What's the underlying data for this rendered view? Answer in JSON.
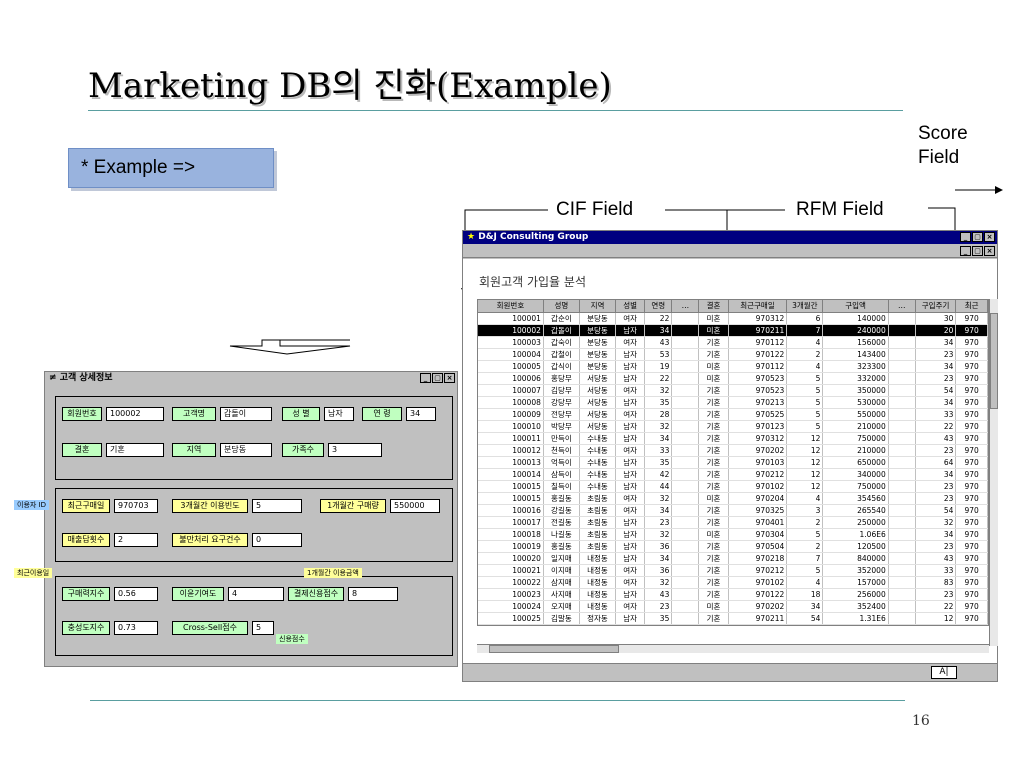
{
  "slide": {
    "title": "Marketing DB의 진화(Example)",
    "example_label": "* Example =>",
    "score_field_label": "Score Field",
    "cif_field_label": "CIF Field",
    "rfm_field_label": "RFM Field",
    "page_number": "16"
  },
  "grid_window": {
    "title": "D&J Consulting Group",
    "heading": "회원고객 가입율 분석",
    "status_text": "A|",
    "columns": [
      "회원번호",
      "성명",
      "지역",
      "성별",
      "연령",
      "…",
      "결혼",
      "최근구매일",
      "3개월간",
      "구입액",
      "…",
      "구입주기",
      "최근"
    ],
    "rows": [
      [
        "100001",
        "갑순이",
        "분당동",
        "여자",
        "22",
        "",
        "미혼",
        "970312",
        "6",
        "140000",
        "",
        "30",
        "970"
      ],
      [
        "100002",
        "갑돌이",
        "분당동",
        "남자",
        "34",
        "",
        "미혼",
        "970211",
        "7",
        "240000",
        "",
        "20",
        "970"
      ],
      [
        "100003",
        "갑숙이",
        "분당동",
        "여자",
        "43",
        "",
        "기혼",
        "970112",
        "4",
        "156000",
        "",
        "34",
        "970"
      ],
      [
        "100004",
        "갑철이",
        "분당동",
        "남자",
        "53",
        "",
        "기혼",
        "970122",
        "2",
        "143400",
        "",
        "23",
        "970"
      ],
      [
        "100005",
        "갑식이",
        "분당동",
        "남자",
        "19",
        "",
        "미혼",
        "970112",
        "4",
        "323300",
        "",
        "34",
        "970"
      ],
      [
        "100006",
        "홍당무",
        "서당동",
        "남자",
        "22",
        "",
        "미혼",
        "970523",
        "5",
        "332000",
        "",
        "23",
        "970"
      ],
      [
        "100007",
        "김당무",
        "서당동",
        "여자",
        "32",
        "",
        "기혼",
        "970523",
        "5",
        "350000",
        "",
        "54",
        "970"
      ],
      [
        "100008",
        "강당무",
        "서당동",
        "남자",
        "35",
        "",
        "기혼",
        "970213",
        "5",
        "530000",
        "",
        "34",
        "970"
      ],
      [
        "100009",
        "전당무",
        "서당동",
        "여자",
        "28",
        "",
        "기혼",
        "970525",
        "5",
        "550000",
        "",
        "33",
        "970"
      ],
      [
        "100010",
        "박당무",
        "서당동",
        "남자",
        "32",
        "",
        "기혼",
        "970123",
        "5",
        "210000",
        "",
        "22",
        "970"
      ],
      [
        "100011",
        "만득이",
        "수내동",
        "남자",
        "34",
        "",
        "기혼",
        "970312",
        "12",
        "750000",
        "",
        "43",
        "970"
      ],
      [
        "100012",
        "천득이",
        "수내동",
        "여자",
        "33",
        "",
        "기혼",
        "970202",
        "12",
        "210000",
        "",
        "23",
        "970"
      ],
      [
        "100013",
        "억득이",
        "수내동",
        "남자",
        "35",
        "",
        "기혼",
        "970103",
        "12",
        "650000",
        "",
        "64",
        "970"
      ],
      [
        "100014",
        "삼득이",
        "수내동",
        "남자",
        "42",
        "",
        "기혼",
        "970212",
        "12",
        "340000",
        "",
        "34",
        "970"
      ],
      [
        "100015",
        "칠득이",
        "수내동",
        "남자",
        "44",
        "",
        "기혼",
        "970102",
        "12",
        "750000",
        "",
        "23",
        "970"
      ],
      [
        "100015",
        "홍길동",
        "초림동",
        "여자",
        "32",
        "",
        "미혼",
        "970204",
        "4",
        "354560",
        "",
        "23",
        "970"
      ],
      [
        "100016",
        "강길동",
        "초림동",
        "여자",
        "34",
        "",
        "기혼",
        "970325",
        "3",
        "265540",
        "",
        "54",
        "970"
      ],
      [
        "100017",
        "전길동",
        "초림동",
        "남자",
        "23",
        "",
        "기혼",
        "970401",
        "2",
        "250000",
        "",
        "32",
        "970"
      ],
      [
        "100018",
        "나길동",
        "초림동",
        "남자",
        "32",
        "",
        "미혼",
        "970304",
        "5",
        "1.06E6",
        "",
        "34",
        "970"
      ],
      [
        "100019",
        "홍길동",
        "초림동",
        "남자",
        "36",
        "",
        "기혼",
        "970504",
        "2",
        "120500",
        "",
        "23",
        "970"
      ],
      [
        "100020",
        "일지매",
        "내정동",
        "남자",
        "34",
        "",
        "기혼",
        "970218",
        "7",
        "840000",
        "",
        "43",
        "970"
      ],
      [
        "100021",
        "이지매",
        "내정동",
        "여자",
        "36",
        "",
        "기혼",
        "970212",
        "5",
        "352000",
        "",
        "33",
        "970"
      ],
      [
        "100022",
        "삼지매",
        "내정동",
        "여자",
        "32",
        "",
        "기혼",
        "970102",
        "4",
        "157000",
        "",
        "83",
        "970"
      ],
      [
        "100023",
        "사지매",
        "내정동",
        "남자",
        "43",
        "",
        "기혼",
        "970122",
        "18",
        "256000",
        "",
        "23",
        "970"
      ],
      [
        "100024",
        "오지매",
        "내정동",
        "여자",
        "23",
        "",
        "미혼",
        "970202",
        "34",
        "352400",
        "",
        "22",
        "970"
      ],
      [
        "100025",
        "김말동",
        "정자동",
        "남자",
        "35",
        "",
        "기혼",
        "970211",
        "54",
        "1.31E6",
        "",
        "12",
        "970"
      ]
    ]
  },
  "detail_window": {
    "title": "고객 상세정보",
    "fields": {
      "member_no_label": "회원번호",
      "member_no": "100002",
      "name_label": "고객명",
      "name": "갑돌이",
      "gender_label": "성 별",
      "gender": "남자",
      "age_label": "연 령",
      "age": "34",
      "marital_label": "결혼",
      "marital": "기혼",
      "region_label": "지역",
      "region": "분당동",
      "family_label": "가족수",
      "family": "3",
      "last_purchase_label": "최근구매일",
      "last_purchase": "970703",
      "freq3m_label": "3개월간 이용빈도",
      "freq3m": "5",
      "amount1m_label": "1개월간 구매량",
      "amount1m": "550000",
      "returns_label": "매출답횟수",
      "returns": "2",
      "complaints_label": "불만처리 요구건수",
      "complaints": "0",
      "purchase_index_label": "구매력지수",
      "purchase_index": "0.56",
      "contribution_label": "이윤기여도",
      "contribution": "4",
      "payment_score_label": "결제신용점수",
      "payment_score": "8",
      "loyalty_label": "충성도지수",
      "loyalty": "0.73",
      "cross_sell_label": "Cross-Sell점수",
      "cross_sell": "5"
    },
    "tags": {
      "user_id": "이용자 ID",
      "recent_use": "최근이용일",
      "monthly_amount": "1개월간 이용금액",
      "credit_score": "신용점수"
    }
  }
}
